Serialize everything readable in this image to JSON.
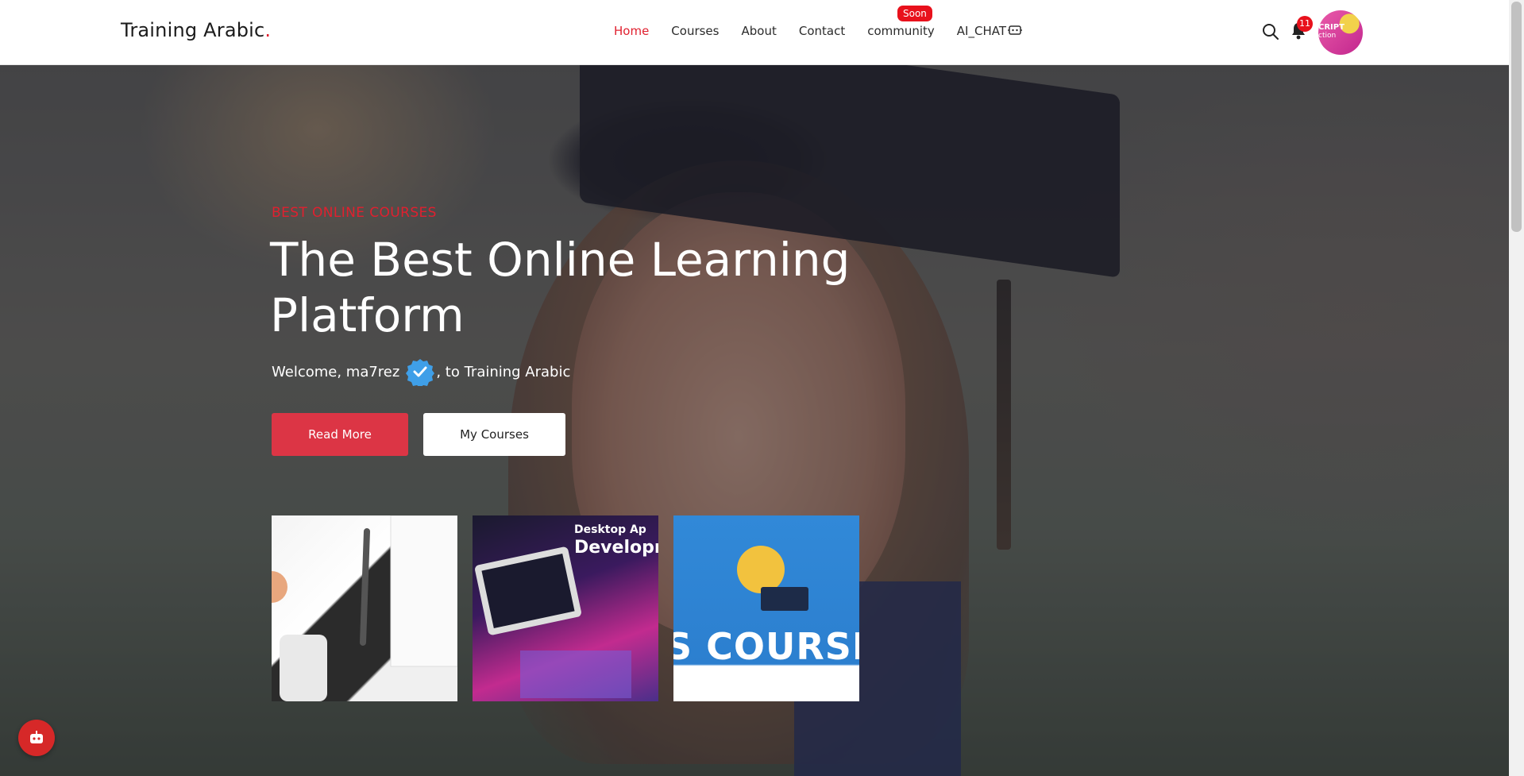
{
  "brand": {
    "name": "Training Arabic",
    "dot": "."
  },
  "nav": {
    "items": [
      {
        "label": "Home",
        "active": true
      },
      {
        "label": "Courses",
        "active": false
      },
      {
        "label": "About",
        "active": false
      },
      {
        "label": "Contact",
        "active": false
      },
      {
        "label": "community",
        "active": false
      },
      {
        "label": "AI_CHAT",
        "active": false
      }
    ],
    "soon_badge": "Soon",
    "notifications_count": "11",
    "avatar_text": "CRIPT",
    "avatar_subtext": "ction"
  },
  "hero": {
    "eyebrow": "BEST ONLINE COURSES",
    "headline": "The Best Online Learning Platform",
    "welcome_prefix": "Welcome, ma7rez",
    "welcome_suffix": ", to Training Arabic",
    "read_more": "Read More",
    "my_courses": "My Courses"
  },
  "thumbnails": [
    {
      "caption": ""
    },
    {
      "caption_small": "Desktop Ap",
      "caption_big": "Developm"
    },
    {
      "caption_big": "S COURSI"
    }
  ],
  "colors": {
    "accent": "#e0202f",
    "primary_button": "#dc3545",
    "badge": "#e8111c"
  }
}
